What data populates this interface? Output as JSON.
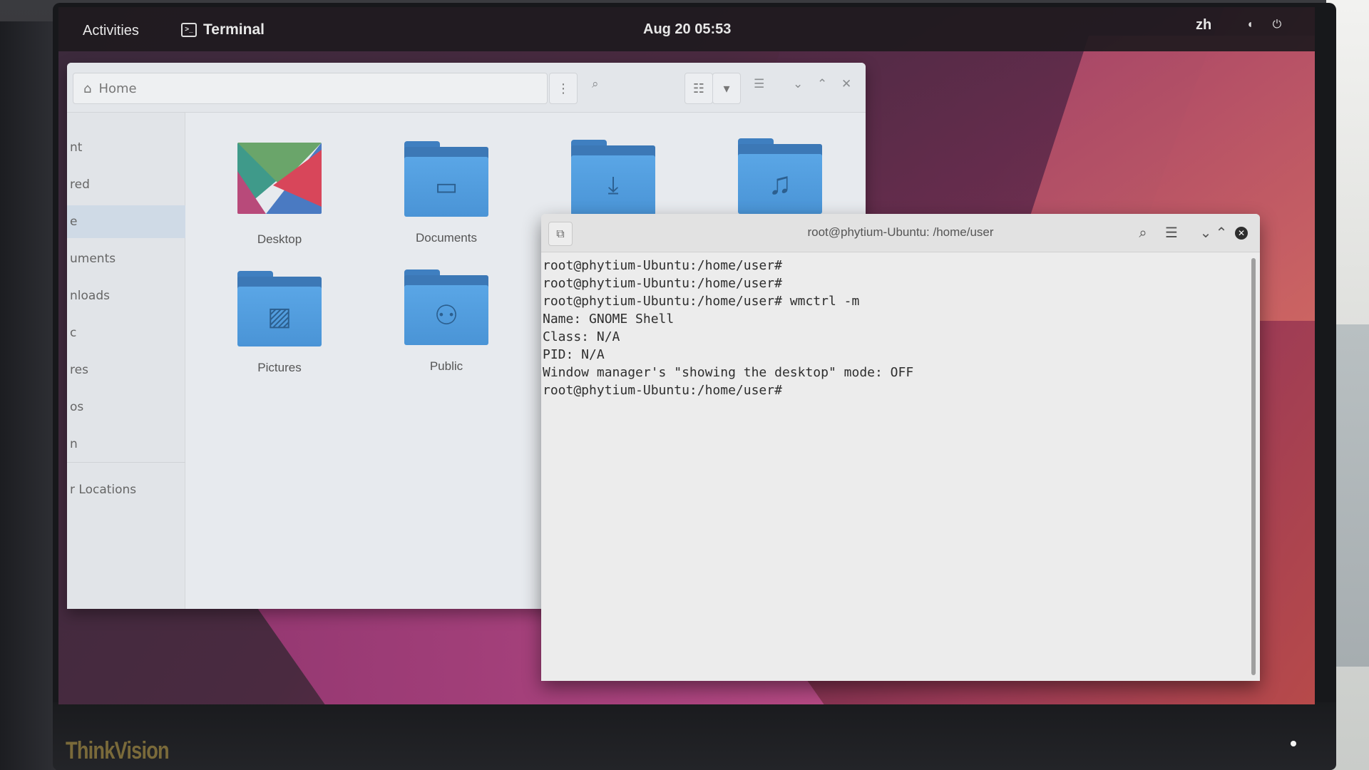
{
  "topbar": {
    "activities": "Activities",
    "app_name": "Terminal",
    "clock": "Aug 20  05:53",
    "lang": "zh"
  },
  "files": {
    "path": "Home",
    "sidebar": [
      {
        "label": "nt"
      },
      {
        "label": "red"
      },
      {
        "label": "e"
      },
      {
        "label": "uments"
      },
      {
        "label": "nloads"
      },
      {
        "label": "c"
      },
      {
        "label": "res"
      },
      {
        "label": "os"
      },
      {
        "label": "n"
      }
    ],
    "sidebar_other": "r Locations",
    "items": [
      {
        "label": "Desktop"
      },
      {
        "label": "Documents"
      },
      {
        "label": "Pictures"
      },
      {
        "label": "Public"
      }
    ]
  },
  "terminal": {
    "title": "root@phytium-Ubuntu: /home/user",
    "lines": [
      "root@phytium-Ubuntu:/home/user#",
      "root@phytium-Ubuntu:/home/user#",
      "root@phytium-Ubuntu:/home/user# wmctrl -m",
      "Name: GNOME Shell",
      "Class: N/A",
      "PID: N/A",
      "Window manager's \"showing the desktop\" mode: OFF",
      "root@phytium-Ubuntu:/home/user#"
    ]
  },
  "monitor": {
    "brand": "ThinkVision"
  },
  "colors": {
    "folder_blue": "#4a94d6",
    "wallpaper_accent": "#b74a4a"
  }
}
